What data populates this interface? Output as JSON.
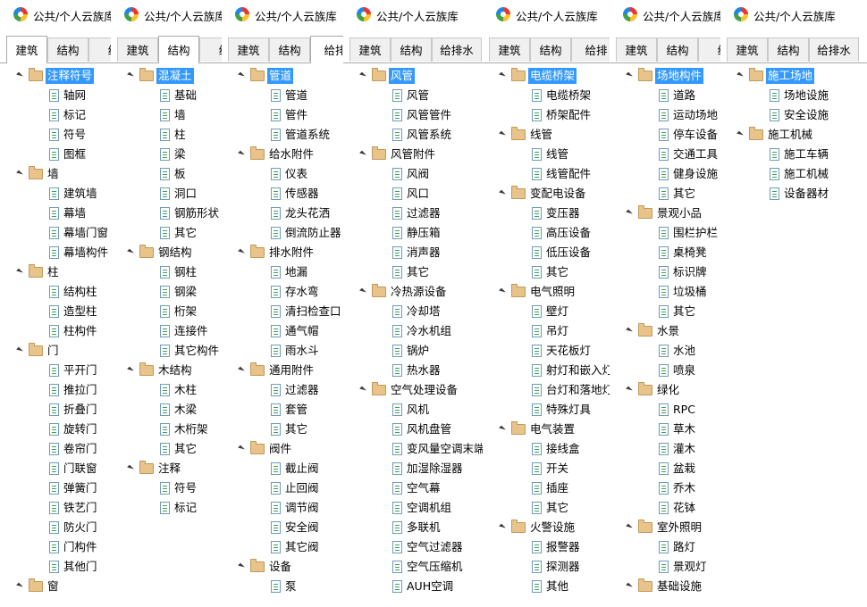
{
  "theme": {
    "selection": "#3399ff",
    "folder": "#e8c38a",
    "leaf_icon_accent": "#3aa15c"
  },
  "title": "公共/个人云族库",
  "icons": {
    "logo": "app-logo-icon",
    "expand": "expanded-arrow-icon",
    "folder": "folder-icon",
    "leaf": "family-file-icon"
  },
  "panels": [
    {
      "tabs": [
        "建筑",
        "结构",
        "给"
      ],
      "active_tab": 0,
      "tree": [
        {
          "label": "注释符号",
          "selected": true,
          "children": [
            "轴网",
            "标记",
            "符号",
            "图框"
          ]
        },
        {
          "label": "墙",
          "children": [
            "建筑墙",
            "幕墙",
            "幕墙门窗",
            "幕墙构件"
          ]
        },
        {
          "label": "柱",
          "children": [
            "结构柱",
            "造型柱",
            "柱构件"
          ]
        },
        {
          "label": "门",
          "children": [
            "平开门",
            "推拉门",
            "折叠门",
            "旋转门",
            "卷帘门",
            "门联窗",
            "弹簧门",
            "铁艺门",
            "防火门",
            "门构件",
            "其他门"
          ]
        },
        {
          "label": "窗",
          "children": []
        }
      ]
    },
    {
      "tabs": [
        "建筑",
        "结构",
        "给"
      ],
      "active_tab": 1,
      "tree": [
        {
          "label": "混凝土",
          "selected": true,
          "children": [
            "基础",
            "墙",
            "柱",
            "梁",
            "板",
            "洞口",
            "钢筋形状",
            "其它"
          ]
        },
        {
          "label": "钢结构",
          "children": [
            "钢柱",
            "钢梁",
            "桁架",
            "连接件",
            "其它构件"
          ]
        },
        {
          "label": "木结构",
          "children": [
            "木柱",
            "木梁",
            "木桁架",
            "其它"
          ]
        },
        {
          "label": "注释",
          "children": [
            "符号",
            "标记"
          ]
        }
      ]
    },
    {
      "tabs": [
        "建筑",
        "结构",
        "给排"
      ],
      "active_tab": 2,
      "tree": [
        {
          "label": "管道",
          "selected": true,
          "children": [
            "管道",
            "管件",
            "管道系统"
          ]
        },
        {
          "label": "给水附件",
          "children": [
            "仪表",
            "传感器",
            "龙头花洒",
            "倒流防止器"
          ]
        },
        {
          "label": "排水附件",
          "children": [
            "地漏",
            "存水弯",
            "清扫检查口",
            "通气帽",
            "雨水斗"
          ]
        },
        {
          "label": "通用附件",
          "children": [
            "过滤器",
            "套管",
            "其它"
          ]
        },
        {
          "label": "阀件",
          "children": [
            "截止阀",
            "止回阀",
            "调节阀",
            "安全阀",
            "其它阀"
          ]
        },
        {
          "label": "设备",
          "children": [
            "泵"
          ]
        }
      ]
    },
    {
      "tabs": [
        "建筑",
        "结构",
        "给排水"
      ],
      "active_tab": -1,
      "tree": [
        {
          "label": "风管",
          "selected": true,
          "children": [
            "风管",
            "风管管件",
            "风管系统"
          ]
        },
        {
          "label": "风管附件",
          "children": [
            "风阀",
            "风口",
            "过滤器",
            "静压箱",
            "消声器",
            "其它"
          ]
        },
        {
          "label": "冷热源设备",
          "children": [
            "冷却塔",
            "冷水机组",
            "锅炉",
            "热水器"
          ]
        },
        {
          "label": "空气处理设备",
          "children": [
            "风机",
            "风机盘管",
            "变风量空调末端",
            "加湿除湿器",
            "空气幕",
            "空调机组",
            "多联机",
            "空气过滤器",
            "空气压缩机",
            "AUH空调"
          ]
        }
      ]
    },
    {
      "tabs": [
        "建筑",
        "结构",
        "给排"
      ],
      "active_tab": -1,
      "tree": [
        {
          "label": "电缆桥架",
          "selected": true,
          "children": [
            "电缆桥架",
            "桥架配件"
          ]
        },
        {
          "label": "线管",
          "children": [
            "线管",
            "线管配件"
          ]
        },
        {
          "label": "变配电设备",
          "children": [
            "变压器",
            "高压设备",
            "低压设备",
            "其它"
          ]
        },
        {
          "label": "电气照明",
          "children": [
            "壁灯",
            "吊灯",
            "天花板灯",
            "射灯和嵌入灯",
            "台灯和落地灯",
            "特殊灯具"
          ]
        },
        {
          "label": "电气装置",
          "children": [
            "接线盒",
            "开关",
            "插座",
            "其它"
          ]
        },
        {
          "label": "火警设施",
          "children": [
            "报警器",
            "探测器",
            "其他"
          ]
        }
      ]
    },
    {
      "tabs": [
        "建筑",
        "结构",
        "给"
      ],
      "active_tab": -1,
      "tree": [
        {
          "label": "场地构件",
          "selected": true,
          "children": [
            "道路",
            "运动场地",
            "停车设备",
            "交通工具",
            "健身设施",
            "其它"
          ]
        },
        {
          "label": "景观小品",
          "children": [
            "围栏护栏",
            "桌椅凳",
            "标识牌",
            "垃圾桶",
            "其它"
          ]
        },
        {
          "label": "水景",
          "children": [
            "水池",
            "喷泉"
          ]
        },
        {
          "label": "绿化",
          "children": [
            "RPC",
            "草木",
            "灌木",
            "盆栽",
            "乔木",
            "花钵"
          ]
        },
        {
          "label": "室外照明",
          "children": [
            "路灯",
            "景观灯"
          ]
        },
        {
          "label": "基础设施",
          "children": []
        }
      ]
    },
    {
      "tabs": [
        "建筑",
        "结构",
        "给排水"
      ],
      "active_tab": -1,
      "tree": [
        {
          "label": "施工场地",
          "selected": true,
          "children": [
            "场地设施",
            "安全设施"
          ]
        },
        {
          "label": "施工机械",
          "children": [
            "施工车辆",
            "施工机械",
            "设备器材"
          ]
        }
      ]
    }
  ]
}
